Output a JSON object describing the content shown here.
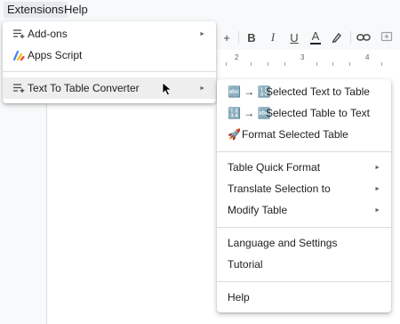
{
  "menubar": {
    "items": [
      {
        "label": "Extensions"
      },
      {
        "label": "Help"
      }
    ]
  },
  "toolbar": {
    "items": [
      {
        "label": "+"
      },
      {
        "label": "B"
      },
      {
        "label": "I"
      },
      {
        "label": "U"
      },
      {
        "label": "A"
      }
    ]
  },
  "ruler": {
    "marks": [
      "2",
      "3",
      "4"
    ]
  },
  "extensions_menu": {
    "items": [
      {
        "label": "Add-ons",
        "icon": "add-ons-icon"
      },
      {
        "label": "Apps Script",
        "icon": "apps-script-icon"
      },
      {
        "label": "Text To Table Converter",
        "icon": "text-to-table-icon"
      }
    ]
  },
  "submenu": {
    "items": [
      {
        "label": "Selected Text to Table",
        "icon_text": "🔤 → 🔢"
      },
      {
        "label": "Selected Table to Text",
        "icon_text": "🔢 → 🔤"
      },
      {
        "label": "Format Selected Table",
        "icon_text": "🚀"
      },
      {
        "label": "Table Quick Format"
      },
      {
        "label": "Translate Selection to"
      },
      {
        "label": "Modify Table"
      },
      {
        "label": "Language and Settings"
      },
      {
        "label": "Tutorial"
      },
      {
        "label": "Help"
      }
    ]
  }
}
